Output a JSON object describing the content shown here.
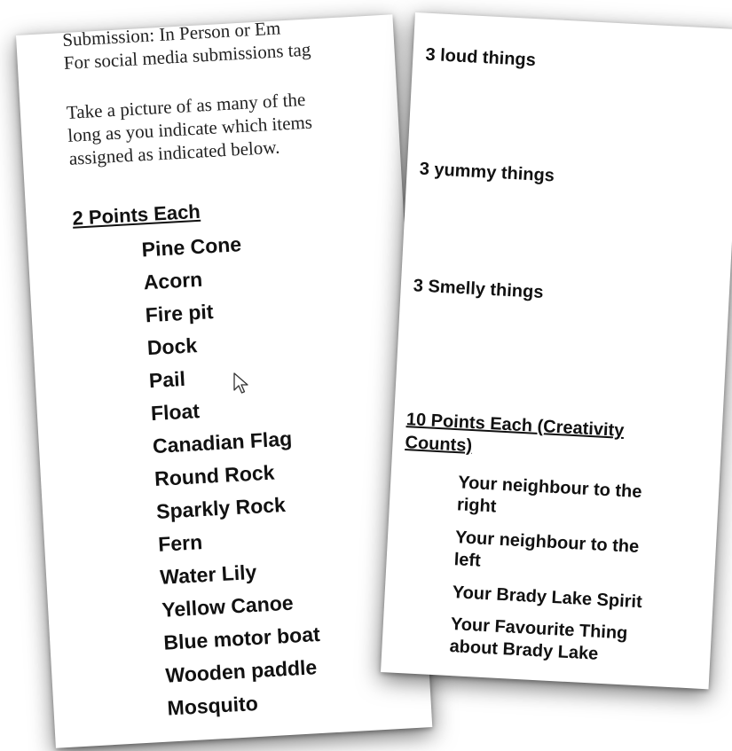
{
  "left_page": {
    "submission_line": "Submission:    In Person  or  Em",
    "social_line": "For social media submissions tag",
    "instructions": [
      "Take a picture of as many of the",
      "long as you indicate which items",
      "assigned as indicated below."
    ],
    "heading": "2 Points Each",
    "items": [
      "Pine Cone",
      "Acorn",
      "Fire pit",
      "Dock",
      "Pail",
      "Float",
      "Canadian Flag",
      "Round Rock",
      "Sparkly Rock",
      "Fern",
      "Water Lily",
      "Yellow Canoe",
      "Blue motor boat",
      "Wooden paddle",
      "Mosquito"
    ]
  },
  "right_page": {
    "groups": [
      "3 loud things",
      "3 yummy things",
      "3 Smelly things"
    ],
    "heading_line1": "10 Points Each (Creativity",
    "heading_line2": "Counts)",
    "items": [
      [
        "Your neighbour to the",
        "right"
      ],
      [
        "Your neighbour to the",
        "left"
      ],
      [
        "Your Brady Lake Spirit"
      ],
      [
        "Your Favourite Thing",
        "about Brady Lake"
      ]
    ]
  },
  "cursor_icon": "mouse-pointer-icon"
}
